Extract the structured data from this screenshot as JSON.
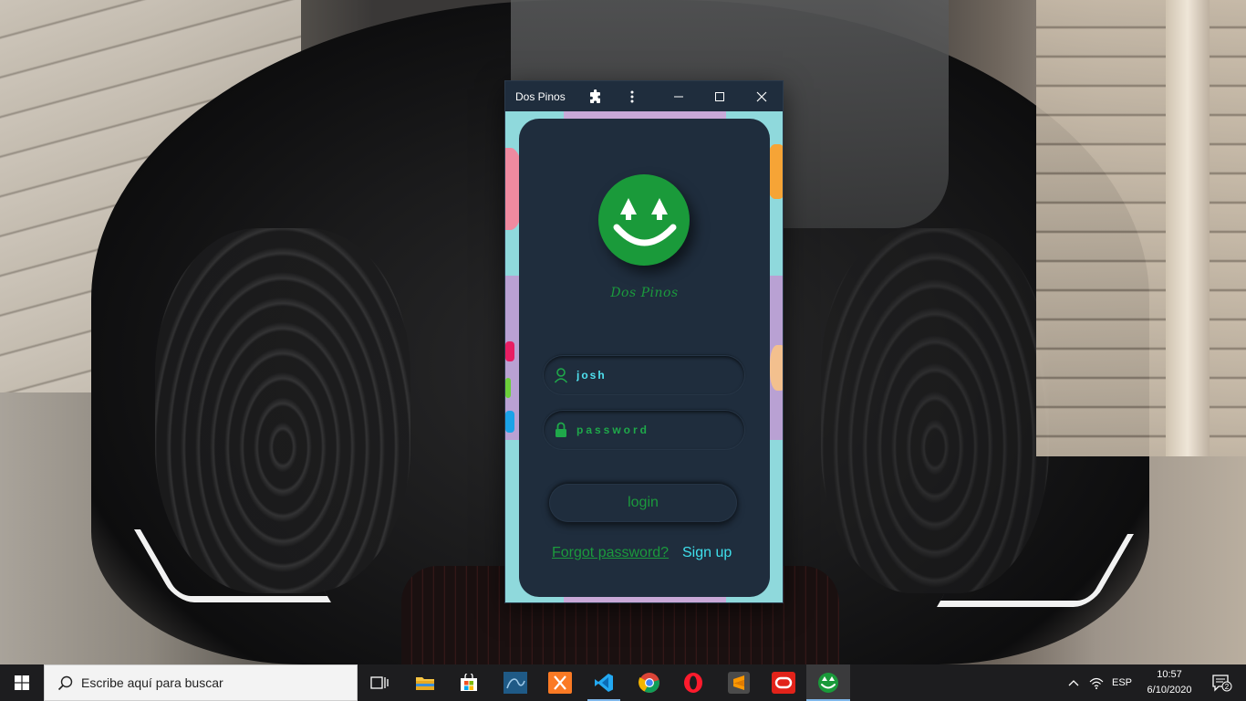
{
  "window": {
    "title": "Dos Pinos",
    "brand_text": "Dos Pinos",
    "icons": {
      "extensions": "puzzle-icon",
      "menu": "kebab-icon",
      "minimize": "minimize-icon",
      "maximize": "maximize-icon",
      "close": "close-icon"
    }
  },
  "login": {
    "username_value": "josh",
    "password_placeholder": "password",
    "login_label": "login",
    "forgot_label": "Forgot password?",
    "signup_label": "Sign up",
    "logo_icon": "smiley-logo-icon"
  },
  "colors": {
    "card_bg": "#1f2d3d",
    "brand_green": "#1b9a3d",
    "accent_cyan": "#3fe0ec",
    "taskbar_bg": "#1d1d1f"
  },
  "taskbar": {
    "search_placeholder": "Escribe aquí para buscar",
    "apps": [
      "task-view-icon",
      "file-explorer-icon",
      "store-icon",
      "mysql-workbench-icon",
      "xampp-icon",
      "vscode-icon",
      "chrome-icon",
      "opera-icon",
      "sublime-text-icon",
      "oracle-icon",
      "dos-pinos-app-icon"
    ],
    "tray": {
      "language": "ESP",
      "time": "10:57",
      "date": "6/10/2020",
      "notification_count": "2"
    }
  }
}
